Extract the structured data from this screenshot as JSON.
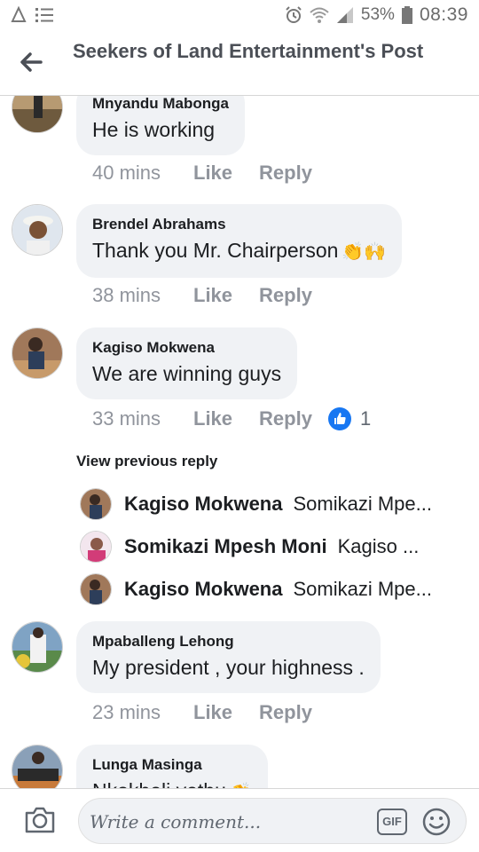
{
  "status_bar": {
    "battery_percent": "53%",
    "time": "08:39",
    "icons": [
      "notification-icon",
      "list-icon",
      "alarm-icon",
      "wifi-icon",
      "signal-icon",
      "battery-icon"
    ]
  },
  "header": {
    "title": "Seekers of Land Entertainment's Post",
    "back_icon": "back-arrow-icon"
  },
  "comments": [
    {
      "author": "Mnyandu Mabonga",
      "text": "He is working",
      "time": "40 mins",
      "like": "Like",
      "reply": "Reply"
    },
    {
      "author": "Brendel Abrahams",
      "text": "Thank you Mr. Chairperson",
      "emoji": "👏🙌",
      "time": "38 mins",
      "like": "Like",
      "reply": "Reply"
    },
    {
      "author": "Kagiso Mokwena",
      "text": "We are winning guys",
      "time": "33 mins",
      "like": "Like",
      "reply": "Reply",
      "reaction_count": "1"
    },
    {
      "author": "Mpaballeng Lehong",
      "text": "My president , your highness .",
      "time": "23 mins",
      "like": "Like",
      "reply": "Reply"
    },
    {
      "author": "Lunga Masinga",
      "text": "Nkokheli yethu",
      "emoji": "👏"
    }
  ],
  "view_previous_reply": "View previous reply",
  "replies": [
    {
      "author": "Kagiso Mokwena",
      "text": "Somikazi Mpe..."
    },
    {
      "author": "Somikazi Mpesh Moni",
      "text": "Kagiso ..."
    },
    {
      "author": "Kagiso Mokwena",
      "text": "Somikazi Mpe..."
    }
  ],
  "composer": {
    "placeholder": "Write a comment...",
    "gif_label": "GIF",
    "camera_icon": "camera-icon",
    "emoji_icon": "smiley-icon"
  },
  "colors": {
    "bubble": "#f0f2f5",
    "meta_text": "#90949c",
    "like_blue": "#1877f2",
    "title_text": "#4b4f56"
  }
}
